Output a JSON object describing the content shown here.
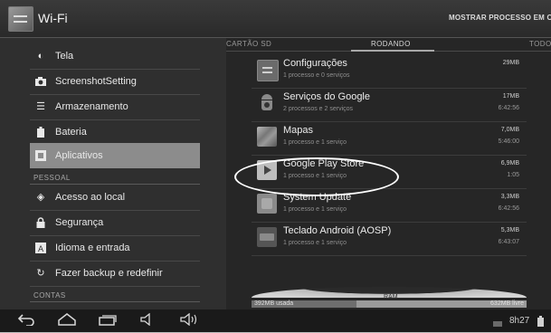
{
  "actionbar": {
    "title": "Wi-Fi",
    "action_label": "MOSTRAR PROCESSO EM CACHE",
    "app_icon": "settings-icon"
  },
  "settings_menu": {
    "items_top": [
      {
        "label": "Tela",
        "icon": "brightness-icon"
      },
      {
        "label": "ScreenshotSetting",
        "icon": "camera-icon"
      },
      {
        "label": "Armazenamento",
        "icon": "storage-icon"
      },
      {
        "label": "Bateria",
        "icon": "battery-icon"
      },
      {
        "label": "Aplicativos",
        "icon": "apps-icon",
        "selected": true
      }
    ],
    "section_personal": "PESSOAL",
    "items_personal": [
      {
        "label": "Acesso ao local",
        "icon": "location-icon"
      },
      {
        "label": "Segurança",
        "icon": "lock-icon"
      },
      {
        "label": "Idioma e entrada",
        "icon": "language-icon"
      },
      {
        "label": "Fazer backup e redefinir",
        "icon": "backup-icon"
      }
    ],
    "section_accounts": "CONTAS"
  },
  "tabs": {
    "sd": "CARTÃO SD",
    "running": "RODANDO",
    "all": "TODOS"
  },
  "processes": [
    {
      "name": "Configurações",
      "desc": "1 processo e 0 serviços",
      "size": "29MB",
      "time": "",
      "icon": "settings-app-icon"
    },
    {
      "name": "Serviços do Google",
      "desc": "2 processos e 2 serviços",
      "size": "17MB",
      "time": "6:42:56",
      "icon": "android-icon"
    },
    {
      "name": "Mapas",
      "desc": "1 processo e 1 serviço",
      "size": "7,0MB",
      "time": "5:46:00",
      "icon": "maps-icon"
    },
    {
      "name": "Google Play Store",
      "desc": "1 processo e 1 serviço",
      "size": "6,9MB",
      "time": "1:05",
      "icon": "play-store-icon"
    },
    {
      "name": "System Update",
      "desc": "1 processo e 1 serviço",
      "size": "3,3MB",
      "time": "6:42:56",
      "icon": "system-update-icon"
    },
    {
      "name": "Teclado Android (AOSP)",
      "desc": "1 processo e 1 serviço",
      "size": "5,3MB",
      "time": "6:43:07",
      "icon": "keyboard-icon"
    }
  ],
  "ram": {
    "label": "RAM",
    "used": "392MB usada",
    "free": "632MB livre",
    "used_fraction": 0.38
  },
  "navbar": {
    "clock": "8h27",
    "buttons": [
      "back-icon",
      "home-icon",
      "recents-icon",
      "volume-down-icon",
      "volume-up-icon"
    ]
  }
}
